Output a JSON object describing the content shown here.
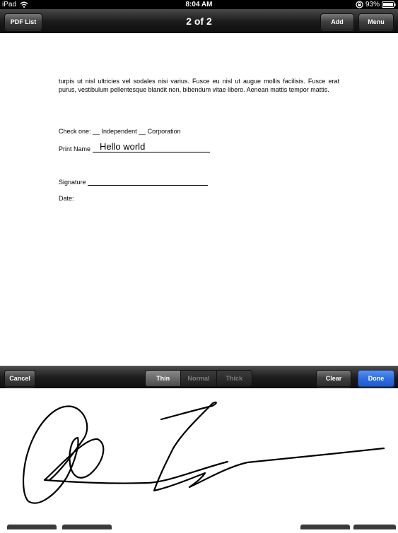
{
  "status": {
    "carrier": "iPad",
    "time": "8:04 AM",
    "battery": "93%"
  },
  "top_toolbar": {
    "left_button": "PDF List",
    "title": "2 of 2",
    "add_button": "Add",
    "menu_button": "Menu"
  },
  "document": {
    "paragraph": "turpis ut nisl ultricies vel sodales nisi varius. Fusce eu nisl ut augue mollis facilisis. Fusce erat purus, vestibulum pellentesque blandit non, bibendum vitae libero. Aenean mattis tempor mattis.",
    "check_label": "Check one: __ Independent  __ Corporation",
    "print_name_label": "Print Name",
    "print_name_value": "Hello world",
    "signature_label": "Signature",
    "date_label": "Date:"
  },
  "signature_toolbar": {
    "cancel": "Cancel",
    "pen_options": [
      "Thin",
      "Normal",
      "Thick"
    ],
    "selected_pen": "Thin",
    "clear": "Clear",
    "done": "Done"
  },
  "colors": {
    "done_button": "#2f6fe0",
    "toolbar": "#1c1c1c"
  }
}
